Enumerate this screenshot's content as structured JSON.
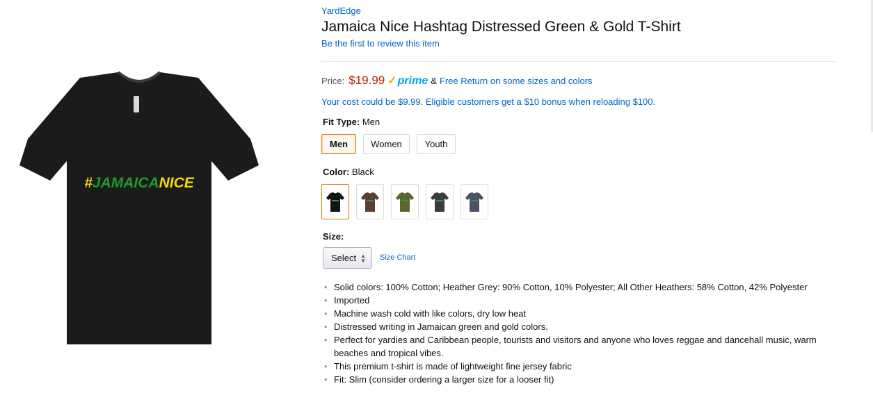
{
  "product": {
    "brand": "YardEdge",
    "title": "Jamaica Nice Hashtag Distressed Green & Gold T-Shirt",
    "review_link": "Be the first to review this item",
    "image": {
      "shirt_color": "#1b1b1b",
      "print_text": "#JAMAICANICE",
      "print_colors": [
        "#f5d800",
        "#1f9a2e"
      ]
    }
  },
  "price": {
    "label": "Price:",
    "value": "$19.99",
    "prime_check": "✓",
    "prime_text": "prime",
    "amp": "&",
    "free_return": "Free Return on some sizes and colors",
    "promo": "Your cost could be $9.99. Eligible customers get a $10 bonus when reloading $100."
  },
  "fit": {
    "label": "Fit Type:",
    "selected": "Men",
    "options": [
      "Men",
      "Women",
      "Youth"
    ]
  },
  "color": {
    "label": "Color:",
    "selected": "Black",
    "swatches": [
      {
        "name": "Black",
        "hex": "#141414"
      },
      {
        "name": "Brown",
        "hex": "#5a3e33"
      },
      {
        "name": "Olive",
        "hex": "#5e6630"
      },
      {
        "name": "Charcoal",
        "hex": "#3d3d3d"
      },
      {
        "name": "Navy",
        "hex": "#4a5168"
      }
    ]
  },
  "size": {
    "label": "Size:",
    "select_value": "Select",
    "chart_link": "Size Chart"
  },
  "bullets": [
    "Solid colors: 100% Cotton; Heather Grey: 90% Cotton, 10% Polyester; All Other Heathers: 58% Cotton, 42% Polyester",
    "Imported",
    "Machine wash cold with like colors, dry low heat",
    "Distressed writing in Jamaican green and gold colors.",
    "Perfect for yardies and Caribbean people, tourists and visitors and anyone who loves reggae and dancehall music, warm beaches and tropical vibes.",
    "This premium t-shirt is made of lightweight fine jersey fabric",
    "Fit: Slim (consider ordering a larger size for a looser fit)"
  ],
  "colors": {
    "link": "#0066c0",
    "price": "#b12704",
    "prime": "#00a8e1",
    "selected_border": "#e77600"
  }
}
